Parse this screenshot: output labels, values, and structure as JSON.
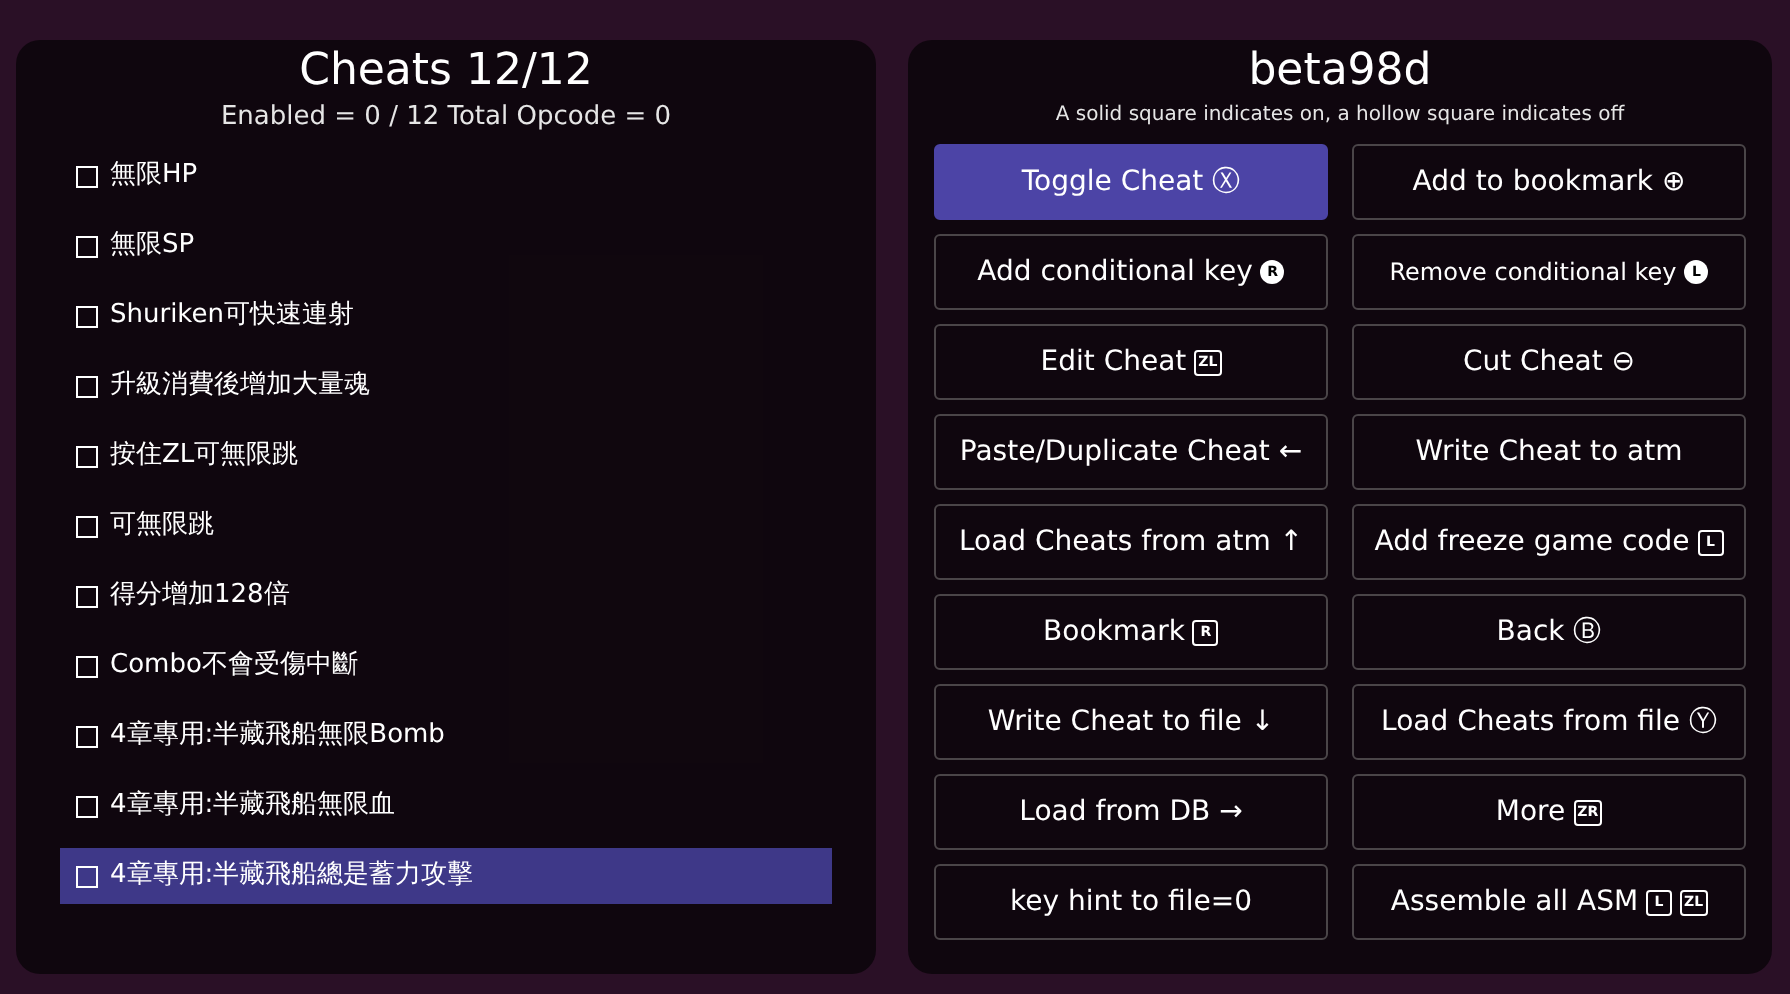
{
  "cheats_panel": {
    "title": "Cheats 12/12",
    "summary": "Enabled = 0 / 12  Total Opcode = 0",
    "items": [
      {
        "label": "無限HP",
        "checked": false,
        "selected": false
      },
      {
        "label": "無限SP",
        "checked": false,
        "selected": false
      },
      {
        "label": "Shuriken可快速連射",
        "checked": false,
        "selected": false
      },
      {
        "label": "升級消費後增加大量魂",
        "checked": false,
        "selected": false
      },
      {
        "label": "按住ZL可無限跳",
        "checked": false,
        "selected": false
      },
      {
        "label": "可無限跳",
        "checked": false,
        "selected": false
      },
      {
        "label": "得分增加128倍",
        "checked": false,
        "selected": false
      },
      {
        "label": "Combo不會受傷中斷",
        "checked": false,
        "selected": false
      },
      {
        "label": "4章專用:半藏飛船無限Bomb",
        "checked": false,
        "selected": false
      },
      {
        "label": "4章專用:半藏飛船無限血",
        "checked": false,
        "selected": false
      },
      {
        "label": "4章專用:半藏飛船總是蓄力攻擊",
        "checked": false,
        "selected": true
      }
    ]
  },
  "menu_panel": {
    "title": "beta98d",
    "hint": "A solid square indicates on, a hollow square indicates off",
    "buttons": [
      {
        "label": "Toggle Cheat Ⓧ",
        "selected": true
      },
      {
        "label": "Add to bookmark ⊕",
        "selected": false
      },
      {
        "label": "Add conditional key",
        "selected": false,
        "keys": [
          {
            "kind": "stick",
            "label": "R"
          }
        ]
      },
      {
        "label": "Remove conditional key",
        "selected": false,
        "keys": [
          {
            "kind": "stick",
            "label": "L"
          }
        ]
      },
      {
        "label": "Edit Cheat",
        "selected": false,
        "keys": [
          {
            "kind": "box",
            "label": "ZL"
          }
        ]
      },
      {
        "label": "Cut Cheat ⊖",
        "selected": false
      },
      {
        "label": "Paste/Duplicate Cheat ←",
        "selected": false
      },
      {
        "label": "Write Cheat to atm",
        "selected": false
      },
      {
        "label": "Load Cheats from atm ↑",
        "selected": false
      },
      {
        "label": "Add freeze game code",
        "selected": false,
        "keys": [
          {
            "kind": "box",
            "label": "L"
          }
        ]
      },
      {
        "label": "Bookmark",
        "selected": false,
        "keys": [
          {
            "kind": "box",
            "label": "R"
          }
        ]
      },
      {
        "label": "Back Ⓑ",
        "selected": false
      },
      {
        "label": "Write Cheat to file ↓",
        "selected": false
      },
      {
        "label": "Load Cheats from file Ⓨ",
        "selected": false
      },
      {
        "label": "Load from DB →",
        "selected": false
      },
      {
        "label": "More",
        "selected": false,
        "keys": [
          {
            "kind": "box",
            "label": "ZR"
          }
        ]
      },
      {
        "label": "key hint to file=0",
        "selected": false
      },
      {
        "label": "Assemble all ASM",
        "selected": false,
        "keys": [
          {
            "kind": "box",
            "label": "L"
          },
          {
            "kind": "box",
            "label": "ZL"
          }
        ]
      }
    ]
  }
}
